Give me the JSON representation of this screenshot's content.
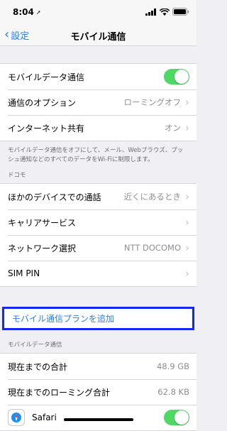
{
  "status_bar": {
    "time": "8:04"
  },
  "nav": {
    "back_label": "設定",
    "title": "モバイル通信"
  },
  "group1": {
    "rows": [
      {
        "label": "モバイルデータ通信",
        "toggle_on": true
      },
      {
        "label": "通信のオプション",
        "value": "ローミングオフ"
      },
      {
        "label": "インターネット共有",
        "value": "オン"
      }
    ],
    "footer": "モバイルデータ通信をオフにして、メール、Webブラウズ、プッシュ通知などのすべてのデータをWi-Fiに制限します。"
  },
  "group2": {
    "header": "ドコモ",
    "rows": [
      {
        "label": "ほかのデバイスでの通話",
        "value": "近くにあるとき"
      },
      {
        "label": "キャリアサービス"
      },
      {
        "label": "ネットワーク選択",
        "value": "NTT DOCOMO"
      },
      {
        "label": "SIM PIN"
      }
    ]
  },
  "add_plan": {
    "label": "モバイル通信プランを追加"
  },
  "usage": {
    "header": "モバイルデータ通信",
    "rows": [
      {
        "label": "現在までの合計",
        "value": "48.9 GB"
      },
      {
        "label": "現在までのローミング合計",
        "value": "62.8 KB"
      },
      {
        "label": "Safari"
      }
    ]
  },
  "colors": {
    "accent": "#2a7cf6",
    "toggle_on": "#4cd964",
    "highlight_border": "#1428f5"
  }
}
